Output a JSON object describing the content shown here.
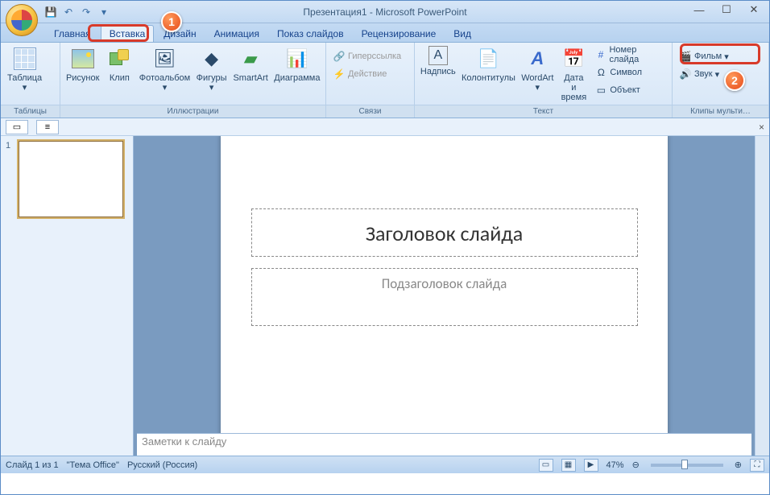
{
  "title": "Презентация1 - Microsoft PowerPoint",
  "tabs": {
    "home": "Главная",
    "insert": "Вставка",
    "design": "Дизайн",
    "anim": "Анимация",
    "show": "Показ слайдов",
    "review": "Рецензирование",
    "view": "Вид"
  },
  "ribbon": {
    "tables": {
      "label": "Таблицы",
      "table": "Таблица"
    },
    "illus": {
      "label": "Иллюстрации",
      "pic": "Рисунок",
      "clip": "Клип",
      "album": "Фотоальбом",
      "shapes": "Фигуры",
      "smartart": "SmartArt",
      "chart": "Диаграмма"
    },
    "links": {
      "label": "Связи",
      "hyper": "Гиперссылка",
      "action": "Действие"
    },
    "text": {
      "label": "Текст",
      "textbox": "Надпись",
      "hf": "Колонтитулы",
      "wordart": "WordArt",
      "date": "Дата и\nвремя",
      "sliden": "Номер слайда",
      "symbol": "Символ",
      "object": "Объект"
    },
    "media": {
      "label": "Клипы мульти…",
      "movie": "Фильм",
      "sound": "Звук"
    }
  },
  "slide": {
    "title_ph": "Заголовок слайда",
    "sub_ph": "Подзаголовок слайда"
  },
  "notes_ph": "Заметки к слайду",
  "status": {
    "slide": "Слайд 1 из 1",
    "theme": "\"Тема Office\"",
    "lang": "Русский (Россия)",
    "zoom": "47%"
  },
  "thumb": {
    "num": "1"
  },
  "badges": {
    "b1": "1",
    "b2": "2"
  }
}
